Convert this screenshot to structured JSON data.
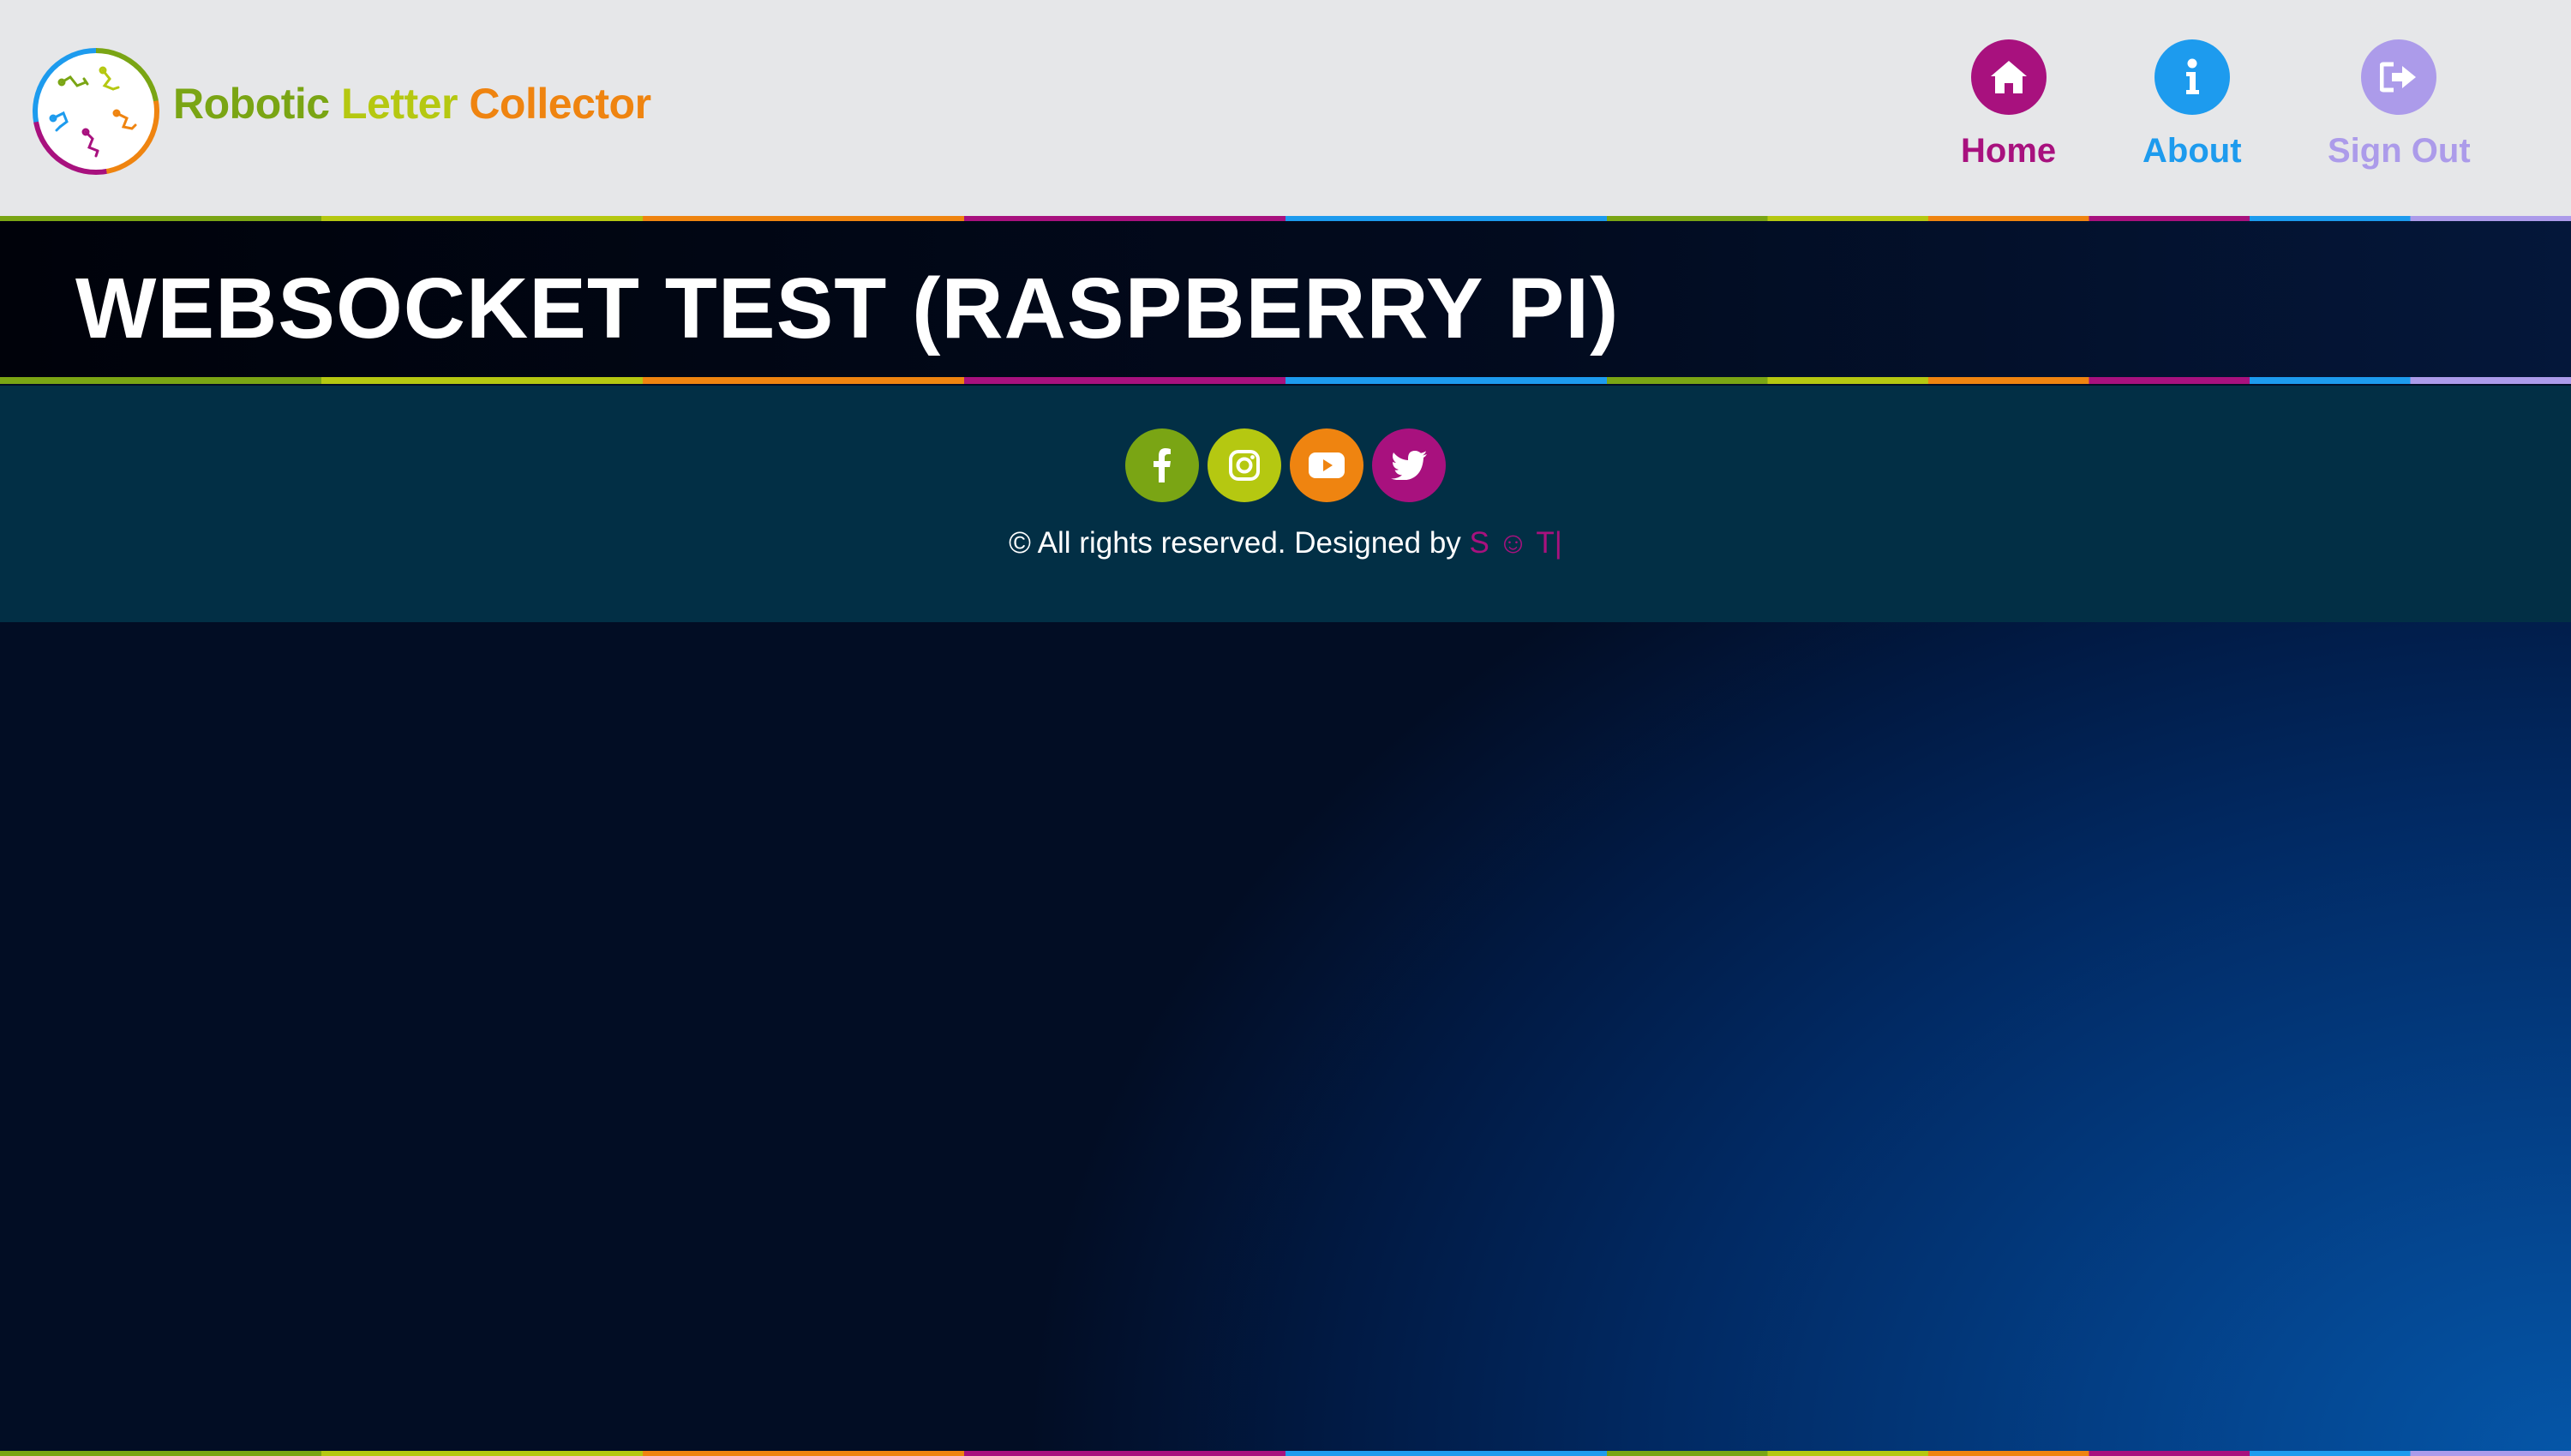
{
  "brand": {
    "title_parts": [
      "Robotic",
      "Letter",
      "Collector"
    ],
    "title_colors": [
      "#7aa514",
      "#b5c811",
      "#ef8410"
    ],
    "logo_icon": "robot-arms-circle-logo"
  },
  "nav": {
    "items": [
      {
        "label": "Home",
        "icon": "home-icon",
        "color": "#a8117e"
      },
      {
        "label": "About",
        "icon": "info-icon",
        "color": "#1d9bee"
      },
      {
        "label": "Sign Out",
        "icon": "sign-out-icon",
        "color": "#ac9bea"
      }
    ]
  },
  "banner": {
    "title": "WEBSOCKET TEST (RASPBERRY PI)"
  },
  "footer": {
    "socials": [
      {
        "icon": "facebook-icon",
        "color": "#7aa514"
      },
      {
        "icon": "instagram-icon",
        "color": "#b5c811"
      },
      {
        "icon": "youtube-icon",
        "color": "#ef8410"
      },
      {
        "icon": "twitter-icon",
        "color": "#a8117e"
      }
    ],
    "copyright_text": "© All rights reserved. Designed by",
    "designer": "S ☺ T|"
  },
  "colors": {
    "header_bg": "#e6e7e9",
    "footer_bg": "#022f45",
    "banner_text": "#ffffff"
  }
}
